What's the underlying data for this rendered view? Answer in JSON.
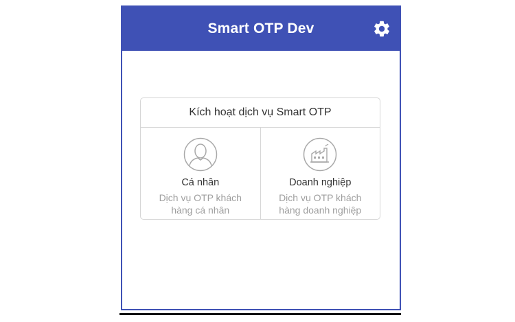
{
  "app": {
    "title": "Smart OTP Dev",
    "accent_color": "#3f51b5",
    "settings_icon": "gear-icon"
  },
  "activation": {
    "heading": "Kích hoạt dịch vụ Smart OTP",
    "options": [
      {
        "icon": "person-icon",
        "title": "Cá nhân",
        "desc_line1": "Dịch vụ OTP khách",
        "desc_line2": "hàng cá nhân"
      },
      {
        "icon": "factory-icon",
        "title": "Doanh nghiệp",
        "desc_line1": "Dịch vụ OTP khách",
        "desc_line2": "hàng doanh nghiệp"
      }
    ]
  }
}
